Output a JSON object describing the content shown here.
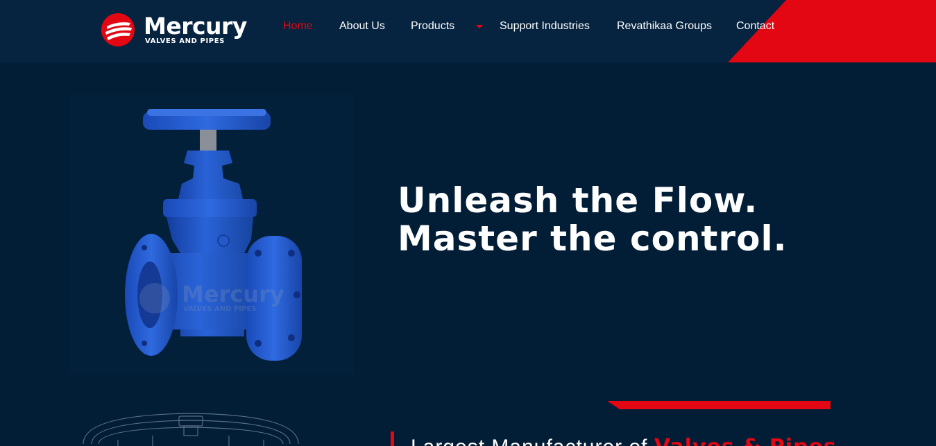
{
  "brand": {
    "name": "Mercury",
    "tagline": "VALVES AND PIPES",
    "watermark": "Mercury",
    "watermark_sub": "VALVES AND PIPES"
  },
  "nav": {
    "items": [
      {
        "label": "Home",
        "active": true
      },
      {
        "label": "About Us"
      },
      {
        "label": "Products",
        "has_dropdown": true
      },
      {
        "label": "Support Industries"
      },
      {
        "label": "Revathikaa Groups"
      },
      {
        "label": "Contact"
      }
    ]
  },
  "hero": {
    "line1": "Unleash the Flow.",
    "line2": "Master the control."
  },
  "intro": {
    "lead": "Largest Manufacturer of ",
    "accent": "Valves & Pipes"
  },
  "colors": {
    "background": "#021d36",
    "header": "#06233f",
    "accent": "#e30613",
    "valve_blue": "#1f55c8"
  }
}
